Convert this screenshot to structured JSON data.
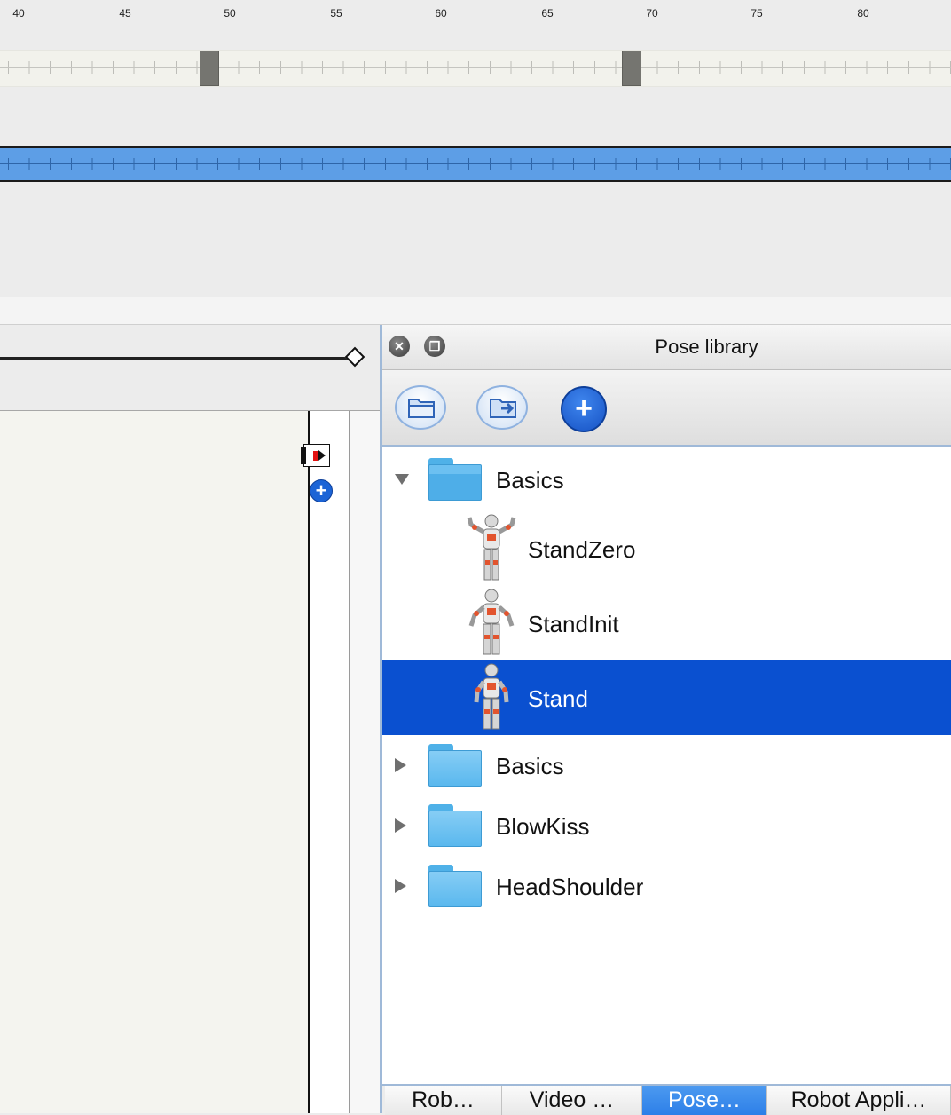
{
  "timeline": {
    "frame_labels": [
      "40",
      "45",
      "50",
      "55",
      "60",
      "65",
      "70",
      "75",
      "80"
    ],
    "keyframes": [
      49,
      69
    ]
  },
  "pose_library": {
    "title": "Pose library",
    "toolbar": {
      "open_icon": "folder-open-icon",
      "import_icon": "folder-import-icon",
      "add_icon": "plus-icon",
      "add_label": "+"
    },
    "tree": [
      {
        "label": "Basics",
        "type": "folder",
        "expanded": true
      },
      {
        "label": "StandZero",
        "type": "pose"
      },
      {
        "label": "StandInit",
        "type": "pose"
      },
      {
        "label": "Stand",
        "type": "pose",
        "selected": true
      },
      {
        "label": "Basics",
        "type": "folder",
        "expanded": false
      },
      {
        "label": "BlowKiss",
        "type": "folder",
        "expanded": false
      },
      {
        "label": "HeadShoulder",
        "type": "folder",
        "expanded": false
      }
    ],
    "colors": {
      "selection": "#0a50d0",
      "folder": "#5ab8ee",
      "accent": "#2d7fe8"
    }
  },
  "left_panel": {
    "add_label": "+"
  },
  "bottom_tabs": [
    {
      "label": "Rob…",
      "active": false
    },
    {
      "label": "Video …",
      "active": false
    },
    {
      "label": "Pose…",
      "active": true
    },
    {
      "label": "Robot Appli…",
      "active": false
    }
  ]
}
